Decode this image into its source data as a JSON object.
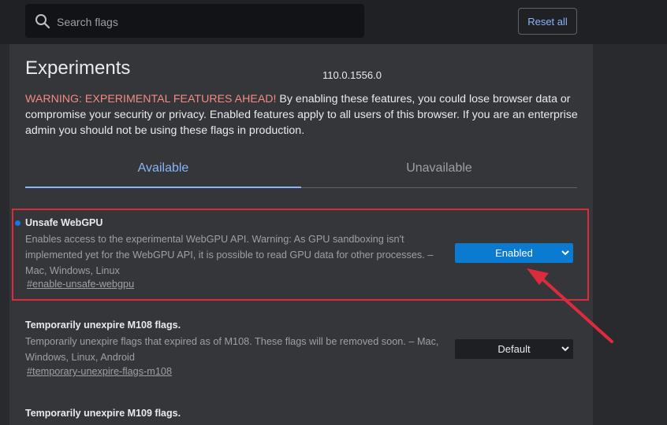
{
  "header": {
    "search_placeholder": "Search flags",
    "reset_label": "Reset all"
  },
  "page": {
    "title": "Experiments",
    "version": "110.0.1556.0",
    "warning_prefix": "WARNING: EXPERIMENTAL FEATURES AHEAD!",
    "warning_body": " By enabling these features, you could lose browser data or compromise your security or privacy. Enabled features apply to all users of this browser. If you are an enterprise admin you should not be using these flags in production."
  },
  "tabs": [
    {
      "label": "Available",
      "active": true
    },
    {
      "label": "Unavailable",
      "active": false
    }
  ],
  "flags": [
    {
      "name": "Unsafe WebGPU",
      "description": "Enables access to the experimental WebGPU API. Warning: As GPU sandboxing isn't implemented yet for the WebGPU API, it is possible to read GPU data for other processes. – Mac, Windows, Linux",
      "link": "#enable-unsafe-webgpu",
      "value": "Enabled",
      "modified": true
    },
    {
      "name": "Temporarily unexpire M108 flags.",
      "description": "Temporarily unexpire flags that expired as of M108. These flags will be removed soon. – Mac, Windows, Linux, Android",
      "link": "#temporary-unexpire-flags-m108",
      "value": "Default",
      "modified": false
    },
    {
      "name": "Temporarily unexpire M109 flags.",
      "modified": false
    }
  ],
  "colors": {
    "accent": "#8ab4f8",
    "warning": "#f28b82",
    "enabled_select": "#0b7ad1",
    "annotation": "#dc2b3c"
  },
  "icons": [
    "search-icon",
    "chevron-down-icon",
    "modified-dot"
  ]
}
